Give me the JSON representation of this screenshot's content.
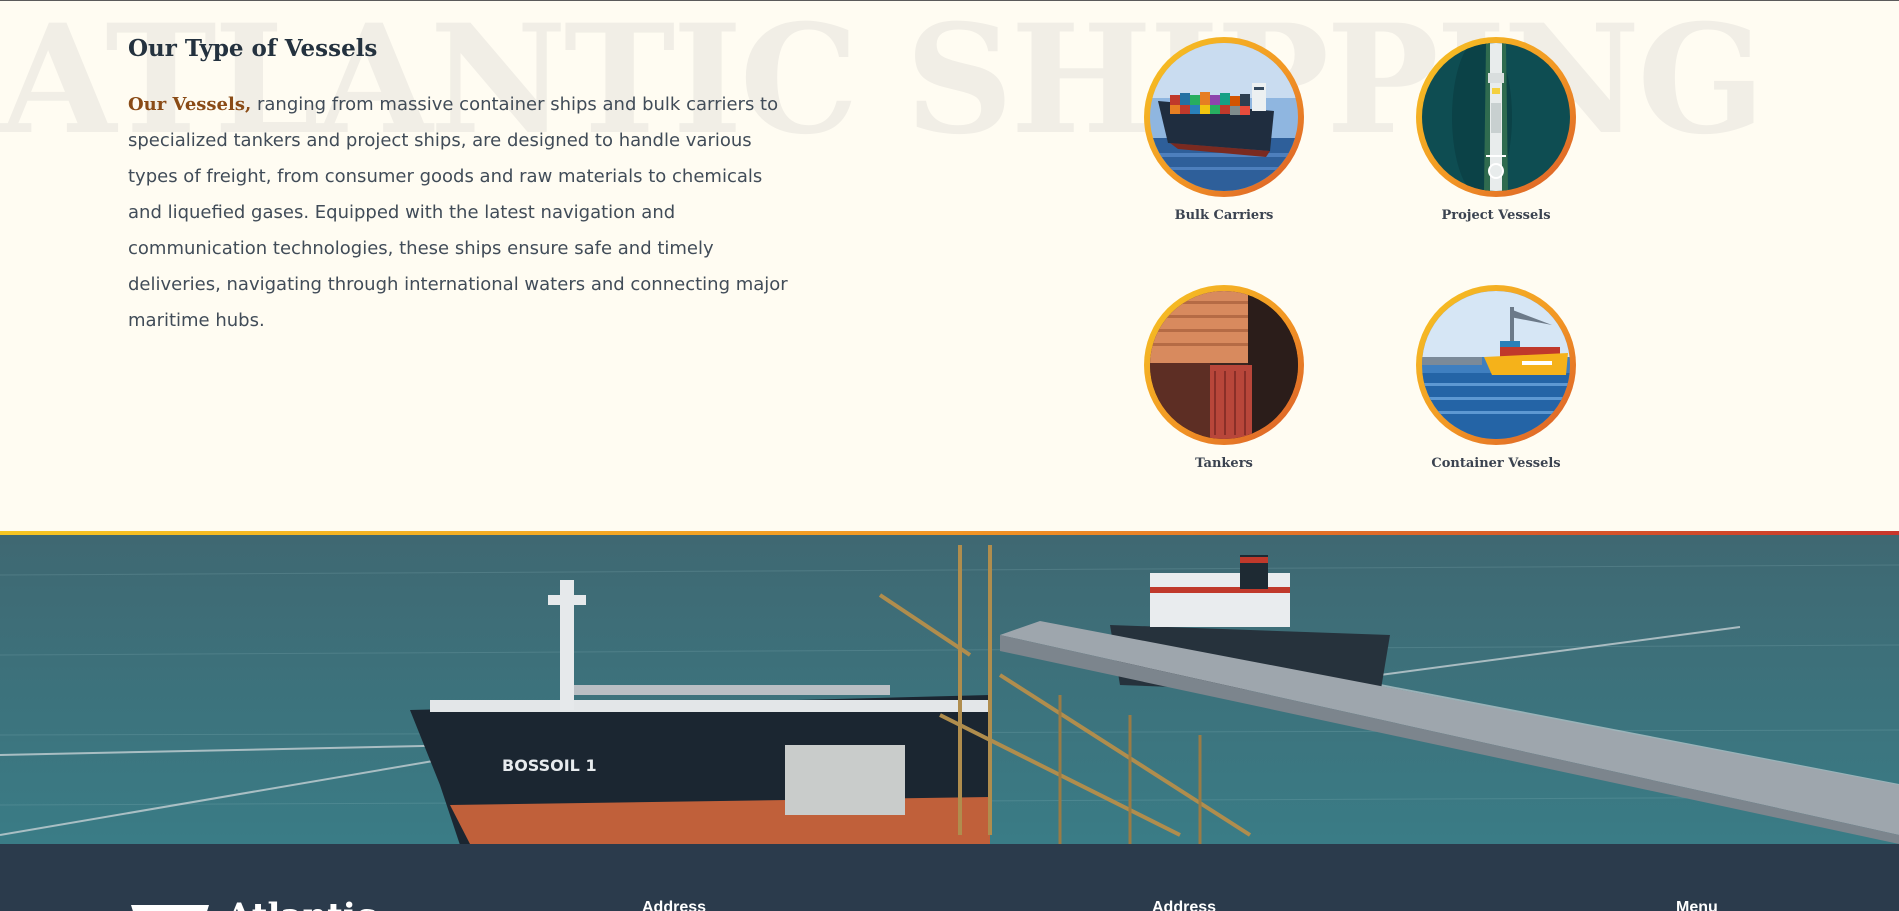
{
  "watermark": "ATLANTIC SHIPPING",
  "vessels": {
    "heading": "Our Type of Vessels",
    "lead": "Our Vessels,",
    "body": "ranging from massive container ships and bulk carriers to specialized tankers and project ships, are designed to handle various types of freight, from consumer goods and raw materials to chemicals and liquefied gases. Equipped with the latest navigation and communication technologies, these ships ensure safe and timely deliveries, navigating through international waters and connecting major maritime hubs.",
    "cards": [
      {
        "label": "Bulk Carriers"
      },
      {
        "label": "Project Vessels"
      },
      {
        "label": "Tankers"
      },
      {
        "label": "Container Vessels"
      }
    ]
  },
  "hero": {
    "hull_text": "BOSSOIL 1"
  },
  "footer": {
    "logo_text": "Atlantic",
    "columns": [
      {
        "label": "Address"
      },
      {
        "label": "Address"
      },
      {
        "label": "Menu"
      }
    ]
  },
  "colors": {
    "accent_gradient": [
      "#f6c623",
      "#f29624",
      "#c9362c"
    ],
    "lead_color": "#8a4b16",
    "footer_bg": "#2b3b4c"
  }
}
